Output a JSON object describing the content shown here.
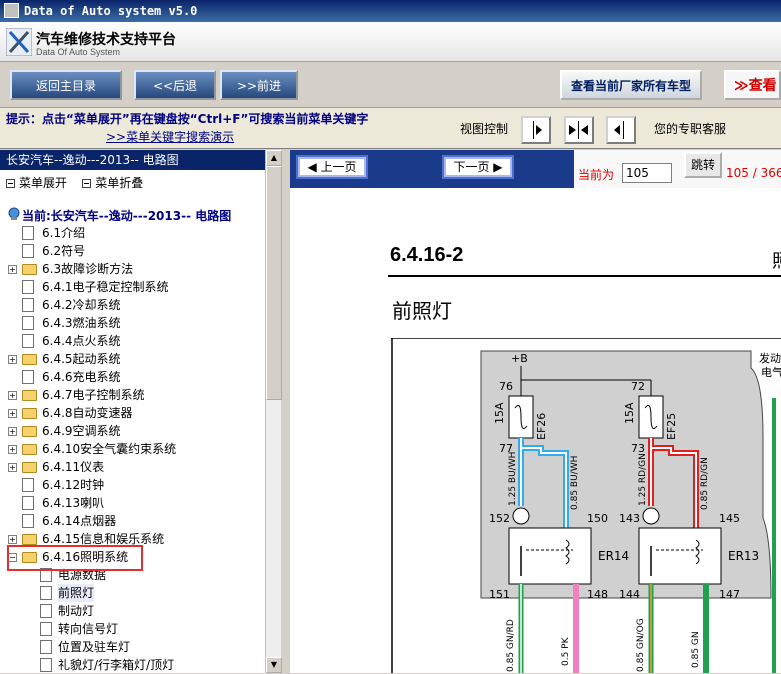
{
  "window": {
    "title": "Data of Auto system v5.0"
  },
  "header": {
    "title": "汽车维修技术支持平台",
    "subtitle": "Data Of Auto System"
  },
  "nav": {
    "home": "返回主目录",
    "back": "<<后退",
    "forward": ">>前进",
    "all_models": "查看当前厂家所有车型",
    "check": "≫查看"
  },
  "hint": {
    "text": "提示：点击“菜单展开”再在键盘按“Ctrl+F”可搜索当前菜单关键字",
    "link": ">>菜单关键字搜索演示",
    "view_control": "视图控制",
    "service": "您的专职客服"
  },
  "tree": {
    "header": "长安汽车--逸动---2013-- 电路图",
    "expand": "菜单展开",
    "collapse": "菜单折叠",
    "current": "当前:长安汽车--逸动---2013-- 电路图",
    "items": [
      {
        "label": "6.1介绍",
        "type": "page",
        "expand": false
      },
      {
        "label": "6.2符号",
        "type": "page",
        "expand": false
      },
      {
        "label": "6.3故障诊断方法",
        "type": "folder",
        "expand": true
      },
      {
        "label": "6.4.1电子稳定控制系统",
        "type": "page",
        "expand": false
      },
      {
        "label": "6.4.2冷却系统",
        "type": "page",
        "expand": false
      },
      {
        "label": "6.4.3燃油系统",
        "type": "page",
        "expand": false
      },
      {
        "label": "6.4.4点火系统",
        "type": "page",
        "expand": false
      },
      {
        "label": "6.4.5起动系统",
        "type": "folder",
        "expand": true
      },
      {
        "label": "6.4.6充电系统",
        "type": "page",
        "expand": false
      },
      {
        "label": "6.4.7电子控制系统",
        "type": "folder",
        "expand": true
      },
      {
        "label": "6.4.8自动变速器",
        "type": "folder",
        "expand": true
      },
      {
        "label": "6.4.9空调系统",
        "type": "folder",
        "expand": true
      },
      {
        "label": "6.4.10安全气囊约束系统",
        "type": "folder",
        "expand": true
      },
      {
        "label": "6.4.11仪表",
        "type": "folder",
        "expand": true
      },
      {
        "label": "6.4.12时钟",
        "type": "page",
        "expand": false
      },
      {
        "label": "6.4.13喇叭",
        "type": "page",
        "expand": false
      },
      {
        "label": "6.4.14点烟器",
        "type": "page",
        "expand": false
      },
      {
        "label": "6.4.15信息和娱乐系统",
        "type": "folder",
        "expand": true
      },
      {
        "label": "6.4.16照明系统",
        "type": "folder-open",
        "expand": true
      }
    ],
    "subitems": [
      {
        "label": "电源数据"
      },
      {
        "label": "前照灯"
      },
      {
        "label": "制动灯"
      },
      {
        "label": "转向信号灯"
      },
      {
        "label": "位置及驻车灯"
      },
      {
        "label": "礼貌灯/行李箱灯/顶灯"
      }
    ]
  },
  "pager": {
    "prev": "上一页",
    "next": "下一页",
    "current_label": "当前为",
    "page_value": "105",
    "jump": "跳转",
    "count": "105 / 366"
  },
  "doc": {
    "section": "6.4.16-2",
    "right_char": "照",
    "title": "前照灯"
  },
  "diagram": {
    "supply": "+B",
    "top_right_1": "发动",
    "top_right_2": "电气",
    "fuse1": {
      "pin_top": "76",
      "pin_bottom": "77",
      "rating": "15A",
      "name": "EF26"
    },
    "fuse2": {
      "pin_top": "72",
      "pin_bottom": "73",
      "rating": "15A",
      "name": "EF25"
    },
    "wire1a": "1.25 BU/WH",
    "wire1b": "0.85 BU/WH",
    "wire2a": "1.25 RD/GN",
    "wire2b": "0.85 RD/GN",
    "relay1": {
      "name": "ER14",
      "p1": "152",
      "p2": "150",
      "p3": "151",
      "p4": "148"
    },
    "relay2": {
      "name": "ER13",
      "p1": "143",
      "p2": "145",
      "p3": "144",
      "p4": "147"
    },
    "wire3": "0.85 GN/RD",
    "wire4": "0.5 PK",
    "wire5": "0.85 GN/OG",
    "wire6": "0.85 GN",
    "colors": {
      "blue": "#33aaee",
      "red": "#e02020",
      "green": "#20a050",
      "pink": "#f080c0",
      "box": "#d0d0d0"
    }
  }
}
